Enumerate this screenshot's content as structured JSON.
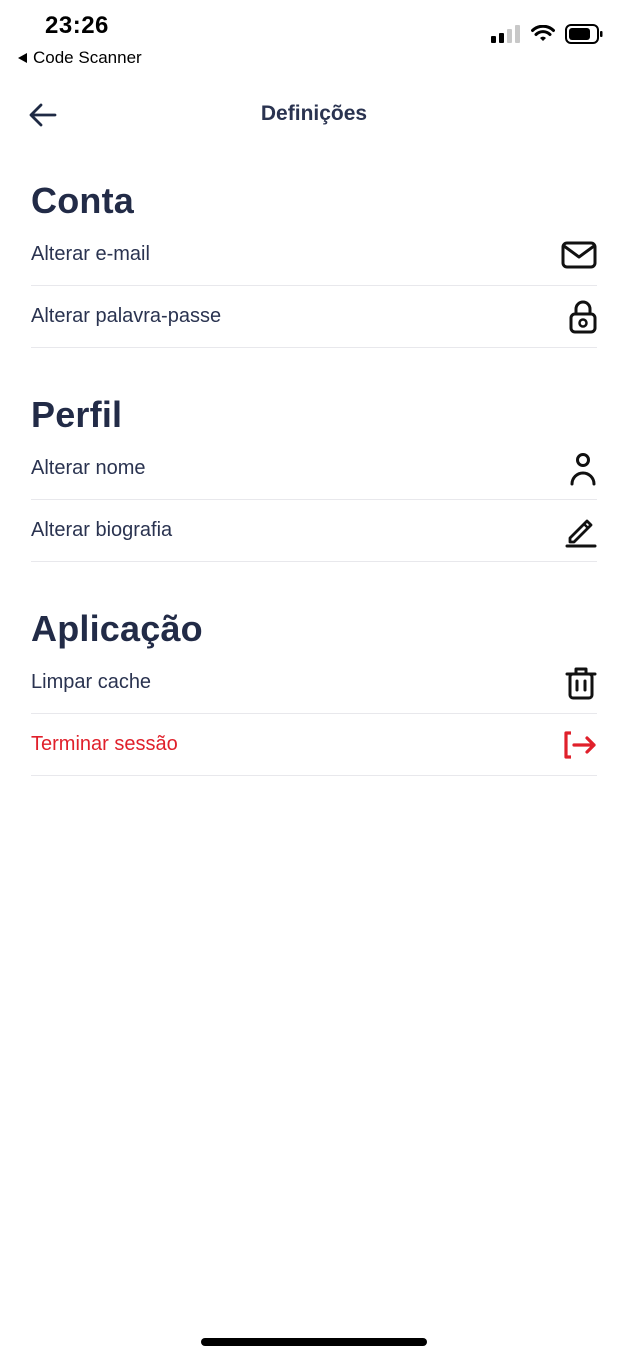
{
  "status_bar": {
    "time": "23:26",
    "back_app": "Code Scanner"
  },
  "header": {
    "title": "Definições"
  },
  "sections": [
    {
      "title": "Conta",
      "items": [
        {
          "label": "Alterar e-mail",
          "icon": "mail-icon"
        },
        {
          "label": "Alterar palavra-passe",
          "icon": "lock-icon"
        }
      ]
    },
    {
      "title": "Perfil",
      "items": [
        {
          "label": "Alterar nome",
          "icon": "user-icon"
        },
        {
          "label": "Alterar biografia",
          "icon": "pencil-icon"
        }
      ]
    },
    {
      "title": "Aplicação",
      "items": [
        {
          "label": "Limpar cache",
          "icon": "trash-icon"
        },
        {
          "label": "Terminar sessão",
          "icon": "logout-icon"
        }
      ]
    }
  ],
  "colors": {
    "text": "#2a3350",
    "heading": "#222b47",
    "danger": "#e0202b",
    "divider": "#e8e8ec"
  }
}
